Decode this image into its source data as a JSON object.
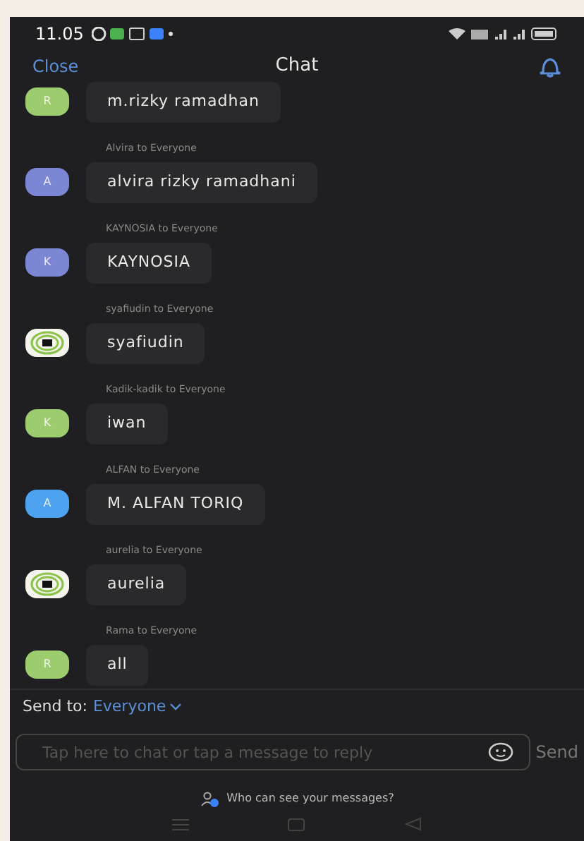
{
  "status_bar": {
    "time": "11.05"
  },
  "header": {
    "close": "Close",
    "title": "Chat"
  },
  "messages": [
    {
      "avatar": {
        "kind": "letter",
        "letter": "R",
        "color": "#9ccc6e"
      },
      "text": "m.rizky ramadhan"
    },
    {
      "sender": "Alvira to Everyone",
      "avatar": {
        "kind": "letter",
        "letter": "A",
        "color": "#7b86d4"
      },
      "text": "alvira rizky ramadhani"
    },
    {
      "sender": "KAYNOSIA to Everyone",
      "avatar": {
        "kind": "letter",
        "letter": "K",
        "color": "#7b86d4"
      },
      "text": "KAYNOSIA"
    },
    {
      "sender": "syafiudin to Everyone",
      "avatar": {
        "kind": "logo"
      },
      "text": "syafiudin"
    },
    {
      "sender": "Kadik-kadik to Everyone",
      "avatar": {
        "kind": "letter",
        "letter": "K",
        "color": "#9ccc6e"
      },
      "text": "iwan"
    },
    {
      "sender": "ALFAN to Everyone",
      "avatar": {
        "kind": "letter",
        "letter": "A",
        "color": "#4ea3f0"
      },
      "text": "M. ALFAN TORIQ"
    },
    {
      "sender": "aurelia to Everyone",
      "avatar": {
        "kind": "logo"
      },
      "text": "aurelia"
    },
    {
      "sender": "Rama to Everyone",
      "avatar": {
        "kind": "letter",
        "letter": "R",
        "color": "#9ccc6e"
      },
      "text": "all"
    }
  ],
  "send_to": {
    "label": "Send to:",
    "value": "Everyone"
  },
  "composer": {
    "placeholder": "Tap here to chat or tap a message to reply",
    "send": "Send"
  },
  "privacy_link": "Who can see your messages?"
}
